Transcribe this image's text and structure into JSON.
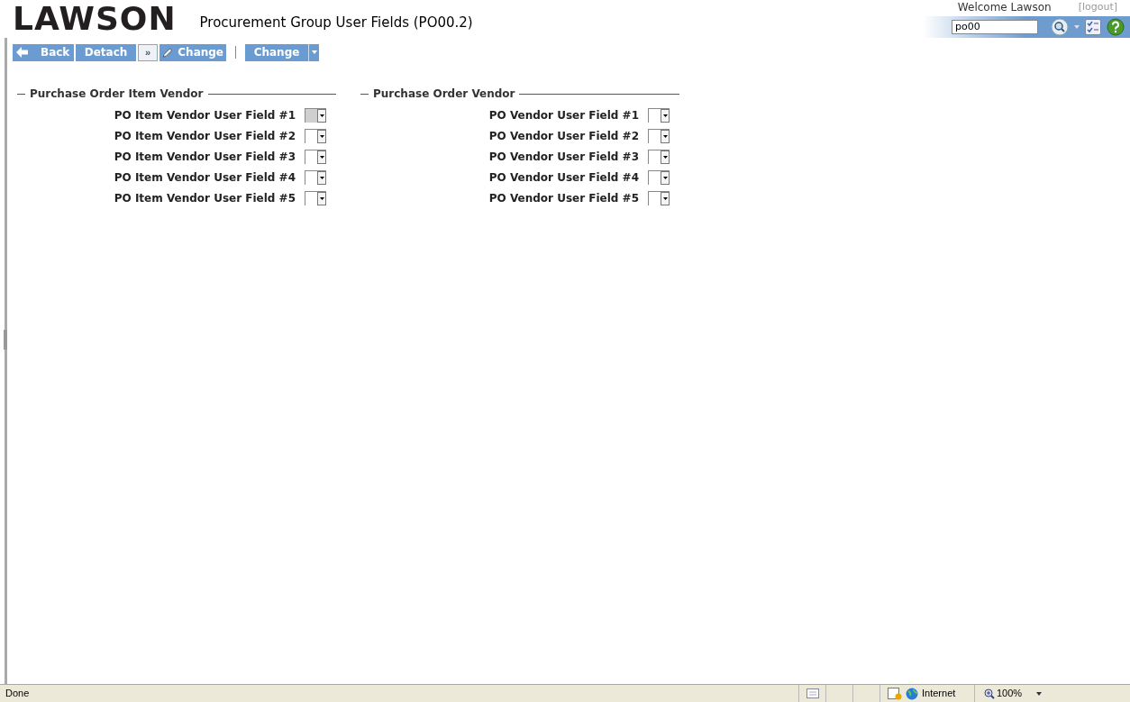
{
  "header": {
    "logo": "LAWSON",
    "title": "Procurement Group User Fields (PO00.2)",
    "welcome": "Welcome Lawson",
    "logout": "[logout]",
    "search_value": "po00"
  },
  "toolbar": {
    "back": "Back",
    "detach": "Detach",
    "more": "»",
    "change": "Change",
    "change_menu": "Change"
  },
  "sections": [
    {
      "title": "Purchase Order Item Vendor",
      "fields": [
        {
          "label": "PO Item Vendor User Field #1",
          "focused": true
        },
        {
          "label": "PO Item Vendor User Field #2",
          "focused": false
        },
        {
          "label": "PO Item Vendor User Field #3",
          "focused": false
        },
        {
          "label": "PO Item Vendor User Field #4",
          "focused": false
        },
        {
          "label": "PO Item Vendor User Field #5",
          "focused": false
        }
      ]
    },
    {
      "title": "Purchase Order Vendor",
      "fields": [
        {
          "label": "PO Vendor User Field #1",
          "focused": false
        },
        {
          "label": "PO Vendor User Field #2",
          "focused": false
        },
        {
          "label": "PO Vendor User Field #3",
          "focused": false
        },
        {
          "label": "PO Vendor User Field #4",
          "focused": false
        },
        {
          "label": "PO Vendor User Field #5",
          "focused": false
        }
      ]
    }
  ],
  "status_bar": {
    "status": "Done",
    "zone": "Internet",
    "zoom": "100%"
  }
}
